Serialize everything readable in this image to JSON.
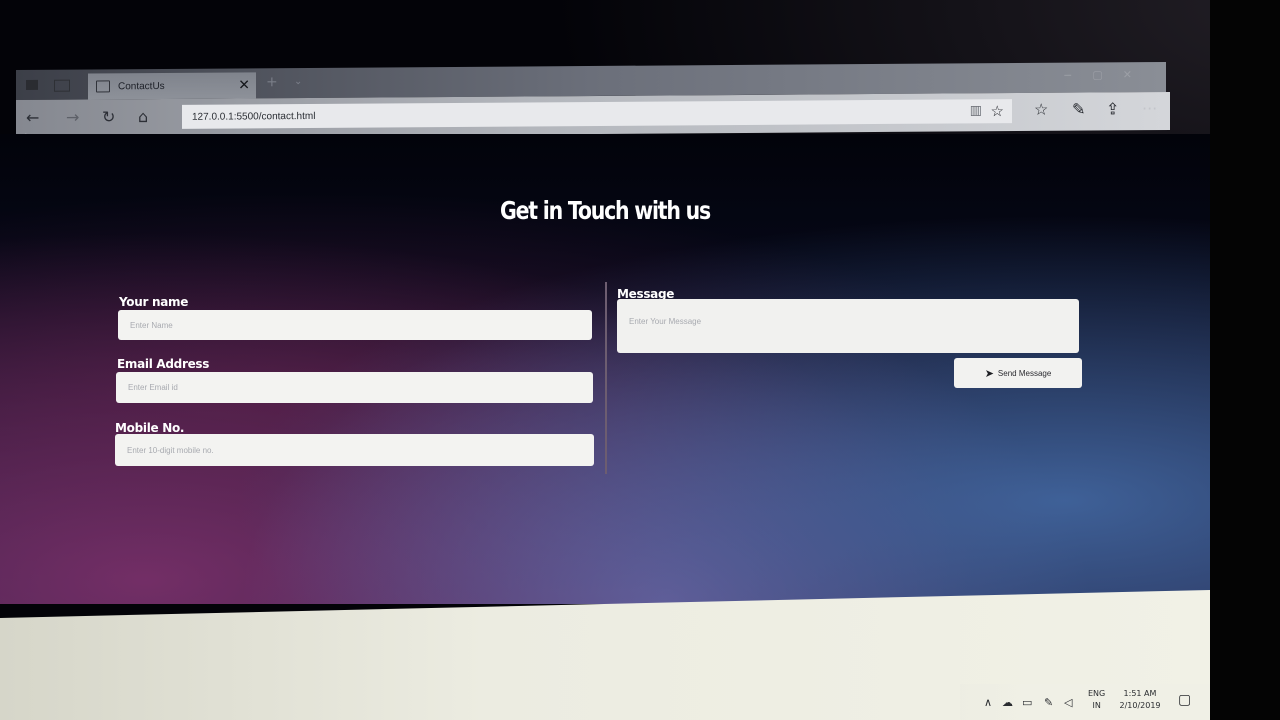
{
  "browser": {
    "tab_title": "ContactUs",
    "url": "127.0.0.1:5500/contact.html",
    "icons": {
      "back": "back-arrow-icon",
      "forward": "forward-arrow-icon",
      "refresh": "refresh-icon",
      "home": "home-icon",
      "reading_view": "reading-view-icon",
      "favorite": "star-icon",
      "favorites_hub": "favorites-icon",
      "pen": "pen-icon",
      "share": "share-icon",
      "more": "more-icon"
    }
  },
  "page": {
    "heading": "Get in Touch with us",
    "form": {
      "name_label": "Your name",
      "name_placeholder": "Enter Name",
      "email_label": "Email Address",
      "email_placeholder": "Enter Email id",
      "mobile_label": "Mobile No.",
      "mobile_placeholder": "Enter 10-digit mobile no.",
      "message_label": "Message",
      "message_placeholder": "Enter Your Message",
      "send_label": "Send Message"
    }
  },
  "taskbar": {
    "language_top": "ENG",
    "language_bottom": "IN",
    "time": "1:51 AM",
    "date": "2/10/2019"
  },
  "colors": {
    "page_gradient_top": "#02030a",
    "page_gradient_pink": "#822c6e",
    "page_gradient_blue": "#466eaa",
    "field_background": "#f3f3f1",
    "heading_text": "#ffffff"
  }
}
